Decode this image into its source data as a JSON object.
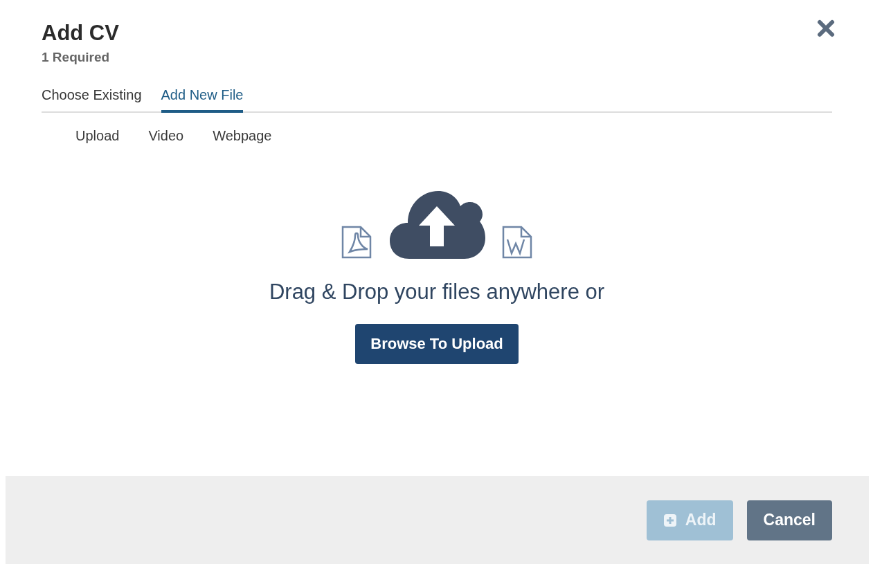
{
  "dialog": {
    "title": "Add CV",
    "subtitle": "1 Required"
  },
  "tabs": [
    {
      "label": "Choose Existing",
      "selected": false
    },
    {
      "label": "Add New File",
      "selected": true
    }
  ],
  "subtabs": [
    "Upload",
    "Video",
    "Webpage"
  ],
  "dropzone": {
    "text": "Drag & Drop your files anywhere or",
    "button": "Browse To Upload"
  },
  "footer": {
    "buttons": [
      {
        "label": "Add",
        "kind": "add",
        "disabled": true
      },
      {
        "label": "Cancel",
        "kind": "cancel",
        "disabled": false
      }
    ]
  }
}
